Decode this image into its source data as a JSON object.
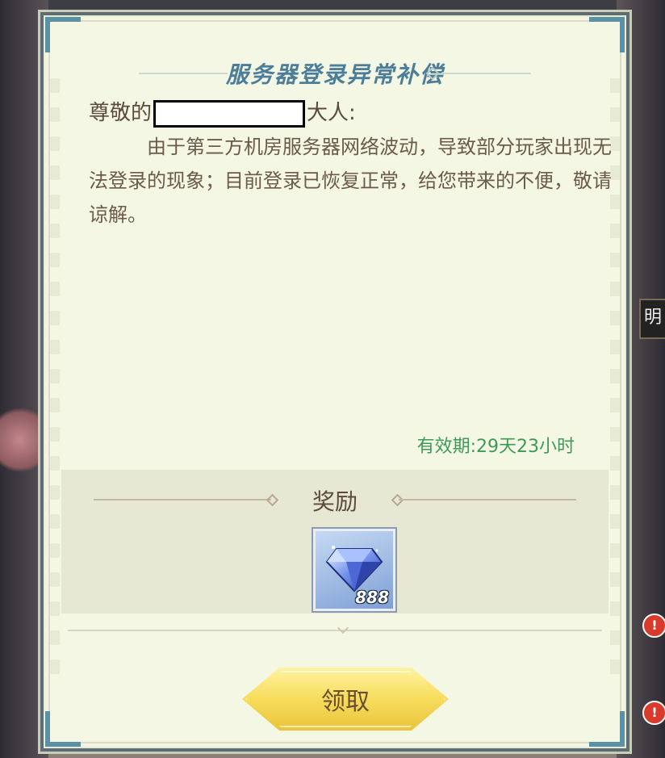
{
  "mail": {
    "title": "服务器登录异常补偿",
    "salutation_prefix": "尊敬的",
    "salutation_suffix": "大人:",
    "body": "由于第三方机房服务器网络波动，导致部分玩家出现无法登录的现象；目前登录已恢复正常，给您带来的不便，敬请谅解。",
    "validity": "有效期:29天23小时"
  },
  "reward": {
    "title": "奖励",
    "items": [
      {
        "icon": "diamond-icon",
        "count": "888"
      }
    ]
  },
  "claim_button": {
    "label": "领取"
  },
  "background": {
    "signboard_char": "明",
    "badges": [
      "!",
      "!"
    ]
  },
  "colors": {
    "title": "#4c7d99",
    "validity": "#3e9a57",
    "button": "#f6dc5c"
  }
}
